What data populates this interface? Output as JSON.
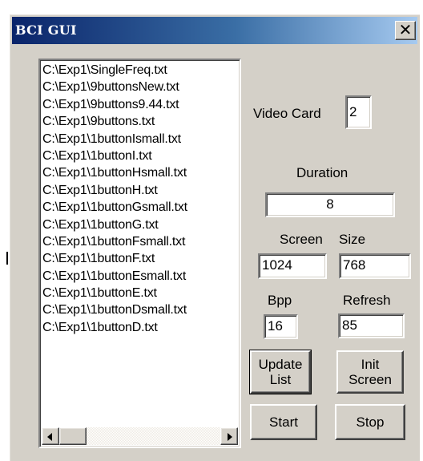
{
  "window": {
    "title": "BCI GUI",
    "close_glyph": "✕"
  },
  "file_list": {
    "items": [
      "C:\\Exp1\\SingleFreq.txt",
      "C:\\Exp1\\9buttonsNew.txt",
      "C:\\Exp1\\9buttons9.44.txt",
      "C:\\Exp1\\9buttons.txt",
      "C:\\Exp1\\1buttonIsmall.txt",
      "C:\\Exp1\\1buttonI.txt",
      "C:\\Exp1\\1buttonHsmall.txt",
      "C:\\Exp1\\1buttonH.txt",
      "C:\\Exp1\\1buttonGsmall.txt",
      "C:\\Exp1\\1buttonG.txt",
      "C:\\Exp1\\1buttonFsmall.txt",
      "C:\\Exp1\\1buttonF.txt",
      "C:\\Exp1\\1buttonEsmall.txt",
      "C:\\Exp1\\1buttonE.txt",
      "C:\\Exp1\\1buttonDsmall.txt",
      "C:\\Exp1\\1buttonD.txt"
    ]
  },
  "settings": {
    "video_card_label": "Video Card",
    "video_card_value": "2",
    "duration_label": "Duration",
    "duration_value": "8",
    "screen_label": "Screen",
    "size_label": "Size",
    "screen_width_value": "1024",
    "screen_height_value": "768",
    "bpp_label": "Bpp",
    "bpp_value": "16",
    "refresh_label": "Refresh",
    "refresh_value": "85"
  },
  "buttons": {
    "update_list_line1": "Update",
    "update_list_line2": "List",
    "init_screen_line1": "Init",
    "init_screen_line2": "Screen",
    "start": "Start",
    "stop": "Stop"
  },
  "colors": {
    "face": "#d4d0c8",
    "title_start": "#0a246a",
    "title_end": "#a6caf0"
  }
}
